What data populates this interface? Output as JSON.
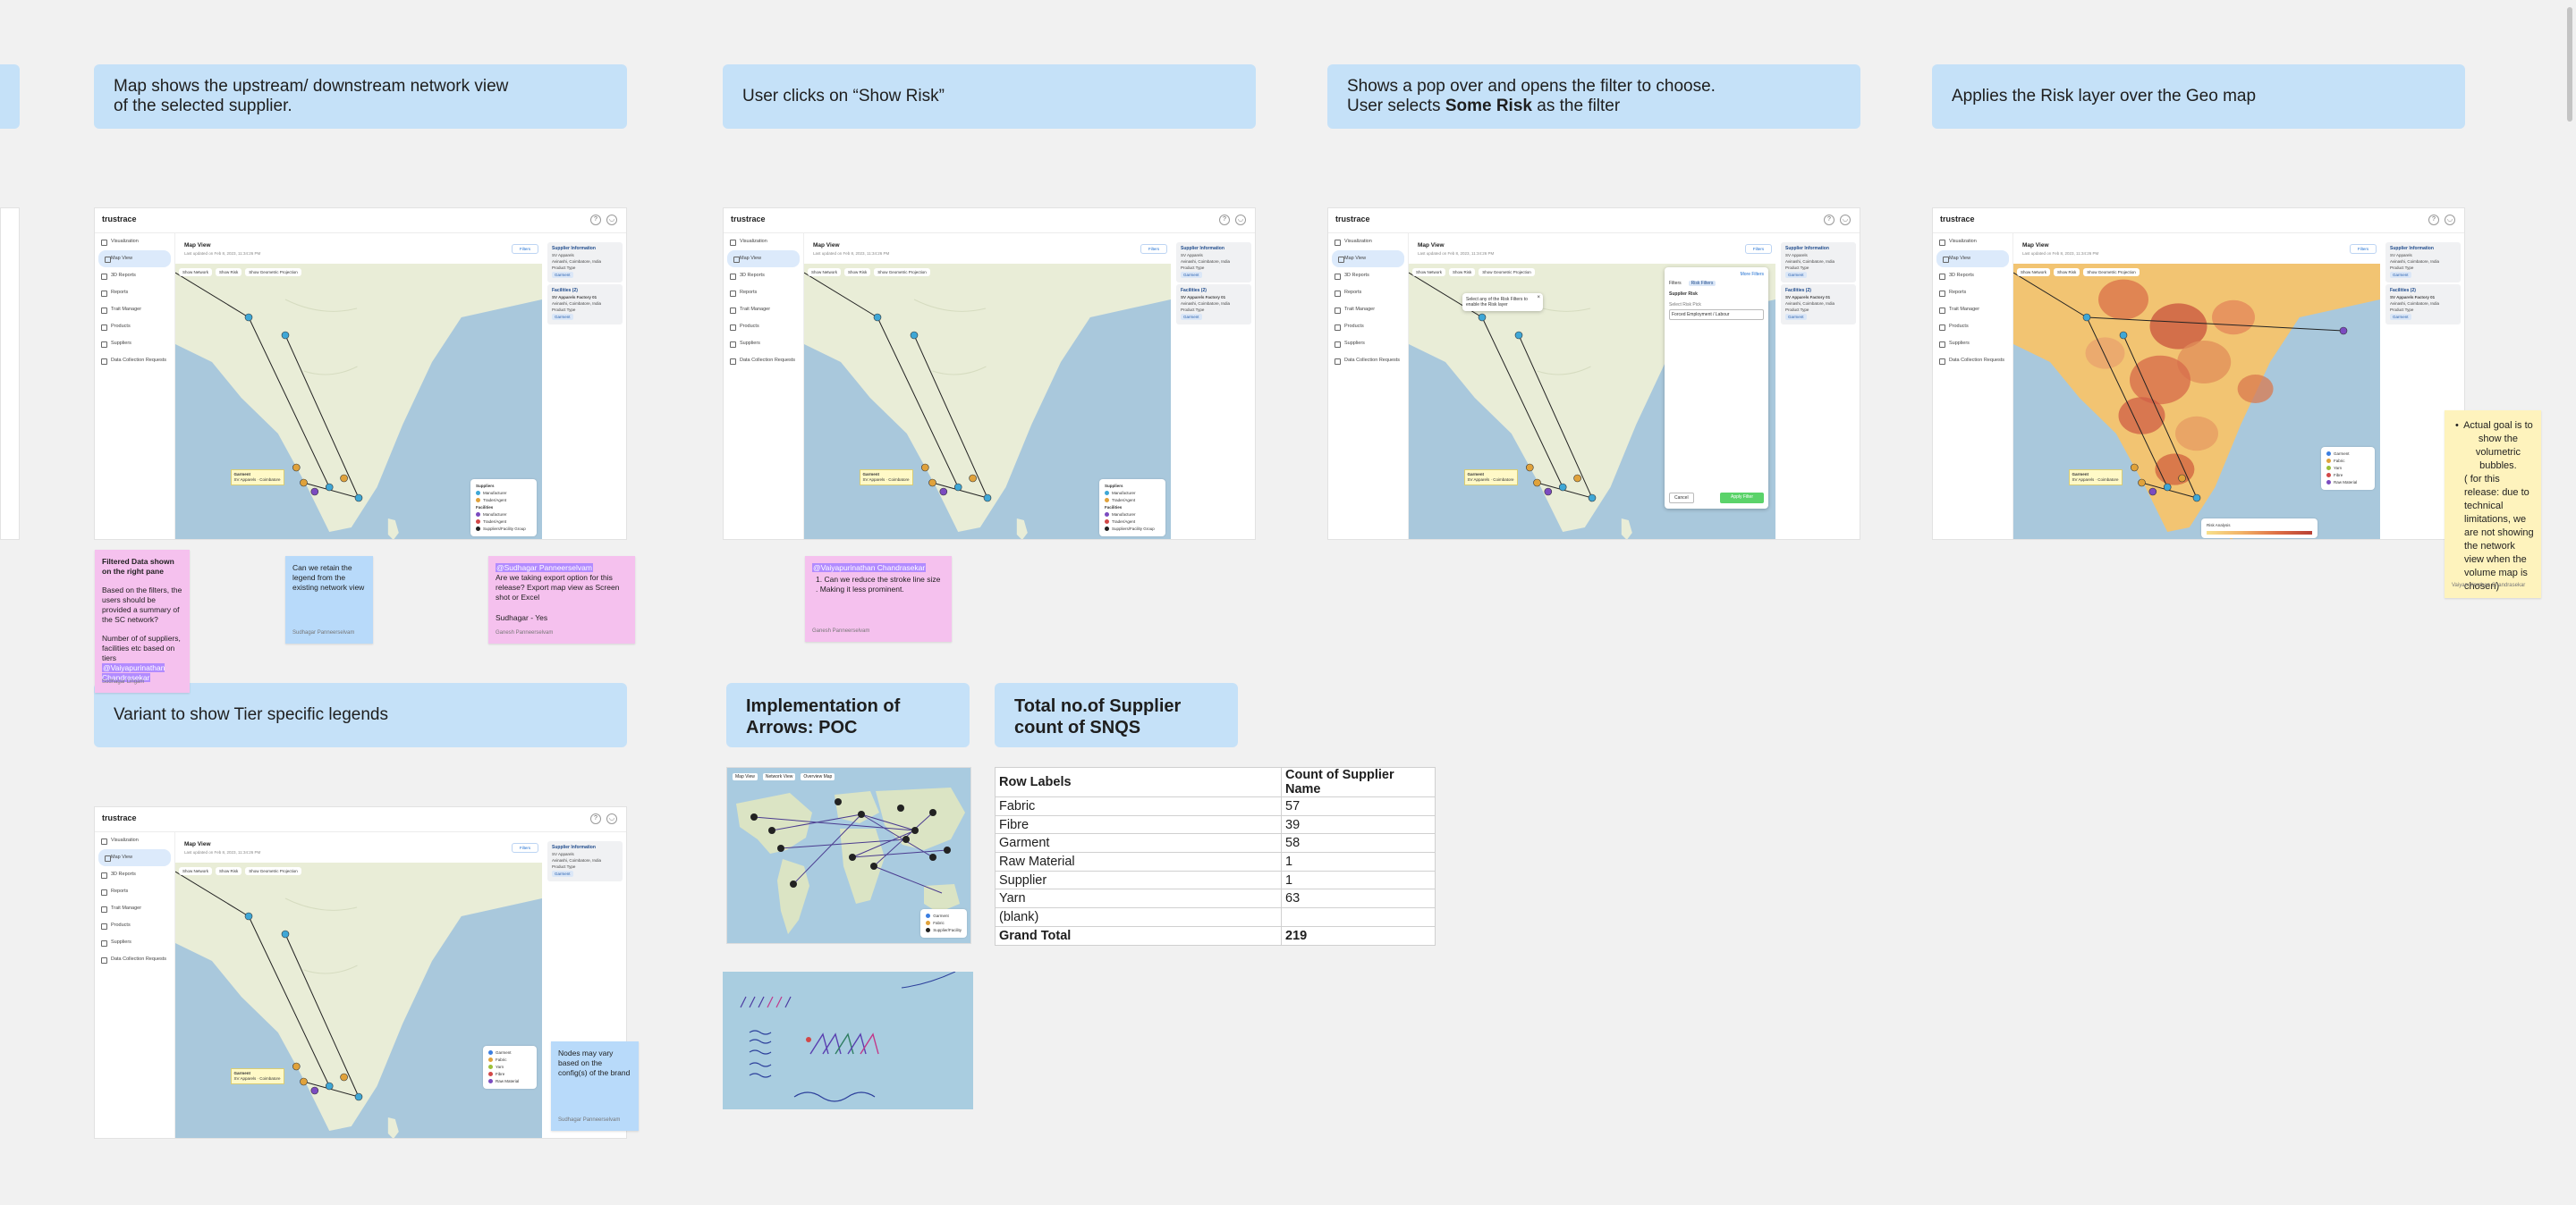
{
  "headers": {
    "h1": "Map shows the upstream/ downstream network view of the selected supplier.",
    "h1_line1": "Map shows the upstream/ downstream network view",
    "h1_line2": "of the selected supplier.",
    "h2": "User clicks on “Show Risk”",
    "h3_line1": "Shows a pop over and opens the filter to choose.",
    "h3_line2_pre": "User selects ",
    "h3_line2_bold": "Some Risk",
    "h3_line2_post": " as the filter",
    "h4": "Applies the Risk layer over the Geo map",
    "h5": "Variant to show Tier specific legends",
    "h6": "Implementation of Arrows: POC",
    "h7": "Total no.of Supplier count of SNQS"
  },
  "stickies": {
    "filtered": {
      "title": "Filtered Data shown on the right pane",
      "p1": "Based on the filters, the users should be provided a summary of the SC network?",
      "p2": "Number of of suppliers, facilities etc based on tiers",
      "mention": "@Vaiyapurinathan Chandrasekar",
      "author": "Sudhagar Lingam"
    },
    "legend_note": {
      "text": "Can we retain the legend from the existing network view",
      "author": "Sudhagar Panneerselvam"
    },
    "export_note": {
      "mention": "@Sudhagar Panneerselvam",
      "text": "Are we taking export option for this release? Export map view as Screen shot or Excel",
      "reply": "Sudhagar - Yes",
      "author": "Ganesh Panneerselvam"
    },
    "stroke_note": {
      "mention": "@Vaiyapurinathan Chandrasekar",
      "text": "1.  Can we reduce the stroke line size . Making it less prominent.",
      "author": "Ganesh Panneerselvam"
    },
    "nodes_note": {
      "text": "Nodes may vary based on the config(s) of the brand",
      "author": "Sudhagar Panneerselvam"
    },
    "goal_note": {
      "text": "Actual goal is to show the volumetric bubbles.",
      "text2": "( for this release: due to technical limitations, we are not showing the network view when the volume map is chosen)",
      "author": "Vaiyapurinathan Chandrasekar"
    }
  },
  "app": {
    "logo": "trustrace",
    "map_view": "Map View",
    "last_updated": "Last updated on Feb 8, 2023, 11:34:26 PM",
    "filters_btn": "Filters",
    "nav": [
      "Visualization",
      "Map View",
      "3D Reports",
      "Reports",
      "Trait Manager",
      "Products",
      "Suppliers",
      "Data Collection Requests"
    ],
    "tools": [
      "Show Network",
      "Show Risk",
      "Show Geometric Projection"
    ],
    "supplier_info": "Supplier Information",
    "sup_name": "SV Apparels",
    "sup_addr": "Avinashi, Coimbatore, India",
    "product_type": "Product Type",
    "garment": "Garment",
    "facilities": "Facilities (2)",
    "factory": "SV Apparels Factory 01",
    "legend_suppliers": "Suppliers",
    "legend_manufacturer": "Manufacturer",
    "legend_trader": "Trader/Agent",
    "legend_facilities": "Facilities",
    "legend_facility_group": "Suppliers/Facility Group",
    "maplabel_title": "Garment",
    "maplabel_sub": "SV Apparels · Coimbatore",
    "tier_legend": [
      "Garment",
      "Fabric",
      "Yarn",
      "Fibre",
      "Raw Material"
    ],
    "risk_legend": [
      "Garment",
      "Fabric",
      "Yarn",
      "Fibre",
      "Raw Material"
    ],
    "risk_scale": "Risk Analysis",
    "filter_pop": {
      "title": "Select any of the Risk Filters to enable the Risk layer",
      "tab1": "Filters",
      "tab2": "Risk Filters",
      "field": "Supplier Risk",
      "select_label": "Select Risk Pick",
      "select_value": "Forced Employment / Labour",
      "cancel": "Cancel",
      "apply": "Apply Filter",
      "more": "More Filters"
    }
  },
  "pivot": {
    "header": [
      "Row Labels",
      "Count of Supplier Name"
    ],
    "rows": [
      [
        "Fabric",
        "57"
      ],
      [
        "Fibre",
        "39"
      ],
      [
        "Garment",
        "58"
      ],
      [
        "Raw Material",
        "1"
      ],
      [
        "Supplier",
        "1"
      ],
      [
        "Yarn",
        "63"
      ],
      [
        "(blank)",
        ""
      ]
    ],
    "total": [
      "Grand Total",
      "219"
    ]
  },
  "poc": {
    "tabs": [
      "Map View",
      "Network View",
      "Overview Map"
    ],
    "legend": [
      "Garment",
      "Fabric",
      "Supplier/Facility"
    ]
  },
  "colors": {
    "header_bg": "#c5e1f8",
    "sticky_pink": "#f5c1ee",
    "sticky_blue": "#b8dafa",
    "sticky_yellow": "#fef3bd",
    "mention": "#b28bff",
    "canvas": "#f1f1f1"
  }
}
